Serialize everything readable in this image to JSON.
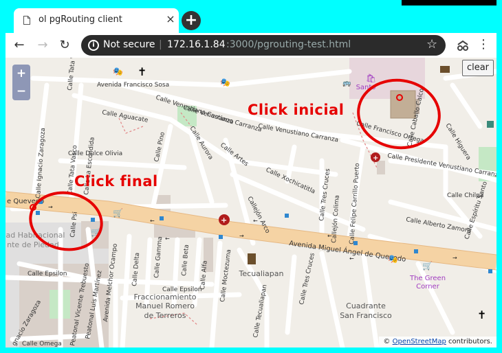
{
  "tab": {
    "title": "ol pgRouting client",
    "close": "×"
  },
  "newtab": "+",
  "window": {
    "minimize": "—",
    "maximize": "☐",
    "close": "✕"
  },
  "toolbar": {
    "back": "←",
    "forward": "→",
    "reload": "↻",
    "secure_label": "Not secure",
    "host": "172.16.1.84",
    "path": ":3000/pgrouting-test.html",
    "star": "☆",
    "menu": "⋮"
  },
  "map": {
    "zoom_in": "+",
    "zoom_out": "−",
    "clear_label": "clear",
    "attribution_prefix": "©",
    "attribution_link": "OpenStreetMap",
    "attribution_suffix": "contributors.",
    "annotations": {
      "start": "Click inicial",
      "end": "Click final"
    },
    "streets": {
      "francisco_sosa": "Avenida Francisco Sosa",
      "carranza_1": "Calle Venustiano Carranza",
      "carranza_2": "Calle Venustiano Carranza",
      "carranza_3": "Calle Venustiano Carranza",
      "pres_carranza": "Calle Presidente Venustiano Carranza",
      "aguacate": "Calle Aguacate",
      "aurora": "Calle Aurora",
      "dulce_olivia": "Calle Dulce Olivia",
      "pino": "Calle Pino",
      "artes": "Calle Artes",
      "xochicatitla": "Calle Xochicatitla",
      "francisco_ortega": "Calle Francisco Ortega",
      "caballo_calco": "Calle Caballo Calco",
      "higuera": "Calle Higuera",
      "chilpa": "Calle Chilpa",
      "alberto_zamora": "Calle Alberto Zamora",
      "espiritu_santo": "Calle Espíritu Santo",
      "tres_cruces": "Calle Tres Cruces",
      "tres_cruces_2": "Calle Tres Cruces",
      "callejon_colima": "Callejón Colima",
      "carrillo_puerto": "Calle Felipe Carrillo Puerto",
      "callejon_arco": "Callejón Arco",
      "queveddo": "Avenida Miguel Ángel de Quevedo",
      "quevedo_short": "e Quevedo",
      "zaragoza": "Calle Ignacio Zaragoza",
      "zaragoza_2": "gnacio Zaragoza",
      "tata_vasco": "Calle Tata Vasco",
      "tata_vasco_2": "Calle Tata Vasco",
      "la_escondida": "Calle La Escondida",
      "psi": "Calle Psi",
      "epsilon": "Calle Epsilon",
      "epsilon_2": "Calle Epsilon",
      "trebuesto": "Peatonal Vicente Trebuesto",
      "martinez": "Peatonal Luis Martínez",
      "ocampo": "Avenida Melchor Ocampo",
      "delta": "Calle Delta",
      "gamma": "Calle Gamma",
      "beta": "Calle Beta",
      "alfa": "Calle Alfa",
      "moctezuma": "Calle Moctezuma",
      "tecualiapan_st": "Calle Tecualiapan",
      "omega": "Calle Omega"
    },
    "places": {
      "tecualiapan": "Tecualiapan",
      "frac_line1": "Fraccionamiento",
      "frac_line2": "Manuel Romero",
      "frac_line3": "de Terreros",
      "cuadrante_line1": "Cuadrante",
      "cuadrante_line2": "San Francisco",
      "green_line1": "The Green",
      "green_line2": "Corner",
      "unidad_line1": "dad Habitacional",
      "unidad_line2": "nte de Piedad",
      "santo_line1": "Santo"
    }
  }
}
